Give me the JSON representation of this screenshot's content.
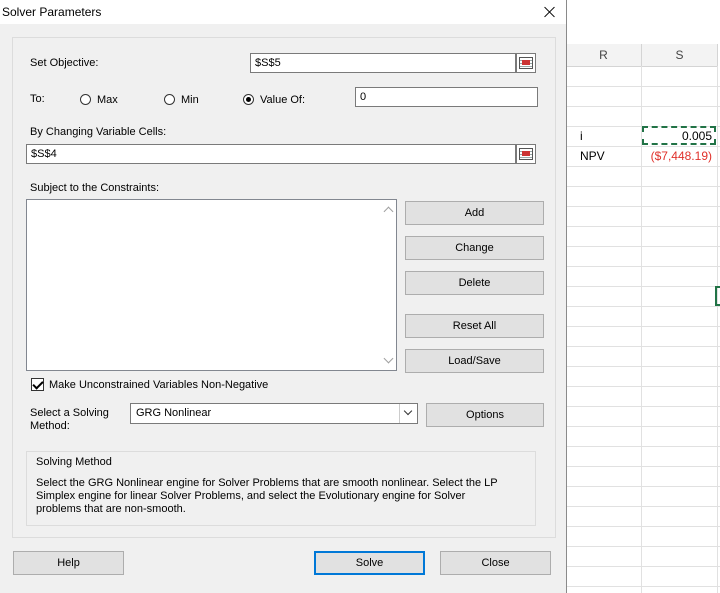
{
  "dialog": {
    "title": "Solver Parameters",
    "set_objective_label": "Set Objective:",
    "set_objective_value": "$S$5",
    "to_label": "To:",
    "opt_max": "Max",
    "opt_min": "Min",
    "opt_value_of": "Value Of:",
    "value_of_value": "0",
    "selected_option": "value_of",
    "changing_cells_label": "By Changing Variable Cells:",
    "changing_cells_value": "$S$4",
    "constraints_label": "Subject to the Constraints:",
    "buttons": {
      "add": "Add",
      "change": "Change",
      "delete": "Delete",
      "reset_all": "Reset All",
      "load_save": "Load/Save",
      "options": "Options",
      "help": "Help",
      "solve": "Solve",
      "close": "Close"
    },
    "nonneg_label": "Make Unconstrained Variables Non-Negative",
    "nonneg_checked": true,
    "solving_method_label_1": "Select a Solving",
    "solving_method_label_2": "Method:",
    "solving_method_value": "GRG Nonlinear",
    "method_group_title": "Solving Method",
    "method_line_1": "Select the GRG Nonlinear engine for Solver Problems that are smooth nonlinear. Select the LP",
    "method_line_2": "Simplex engine for linear Solver Problems, and select the Evolutionary engine for Solver",
    "method_line_3": "problems that are non-smooth."
  },
  "sheet": {
    "columns": [
      "R",
      "S"
    ],
    "r4": "i",
    "s4": "0.005",
    "r5": "NPV",
    "s5": "($7,448.19)",
    "negative_color": "#e0302a",
    "selection_color": "#217346"
  },
  "icons": {
    "close": "close-icon",
    "range_selector": "range-select-icon",
    "dropdown": "chevron-down-icon",
    "scroll_up": "scroll-up-icon",
    "scroll_down": "scroll-down-icon"
  }
}
